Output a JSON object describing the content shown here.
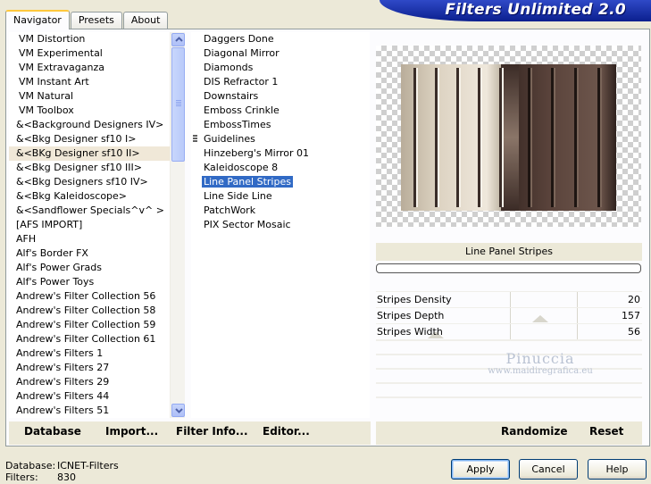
{
  "tabs": [
    {
      "label": "Navigator",
      "active": true
    },
    {
      "label": "Presets",
      "active": false
    },
    {
      "label": "About",
      "active": false
    }
  ],
  "banner": {
    "title": "Filters Unlimited 2.0"
  },
  "categories": [
    "VM Distortion",
    "VM Experimental",
    "VM Extravaganza",
    "VM Instant Art",
    "VM Natural",
    "VM Toolbox",
    "&<Background Designers IV>",
    "&<Bkg Designer sf10 I>",
    "&<BKg Designer sf10 II>",
    "&<Bkg Designer sf10 III>",
    "&<Bkg Designers sf10 IV>",
    "&<Bkg Kaleidoscope>",
    "&<Sandflower Specials^v^ >",
    "[AFS IMPORT]",
    "AFH",
    "Alf's Border FX",
    "Alf's Power Grads",
    "Alf's Power Toys",
    "Andrew's Filter Collection 56",
    "Andrew's Filter Collection 58",
    "Andrew's Filter Collection 59",
    "Andrew's Filter Collection 61",
    "Andrew's Filters 1",
    "Andrew's Filters 27",
    "Andrew's Filters 29",
    "Andrew's Filters 44",
    "Andrew's Filters 51"
  ],
  "selected_category": "&<BKg Designer sf10 II>",
  "filters": [
    "Daggers Done",
    "Diagonal Mirror",
    "Diamonds",
    "DIS Refractor 1",
    "Downstairs",
    "Emboss Crinkle",
    "EmbossTimes",
    "Guidelines",
    "Hinzeberg's Mirror 01",
    "Kaleidoscope 8",
    "Line Panel Stripes",
    "Line Side Line",
    "PatchWork",
    "PIX Sector Mosaic"
  ],
  "selected_filter": "Line Panel Stripes",
  "preview": {
    "filter_name": "Line Panel Stripes",
    "colors": {
      "light": "#ddd3c2",
      "dark": "#5b443c"
    }
  },
  "params": [
    {
      "name": "Stripes Density",
      "value": "20"
    },
    {
      "name": "Stripes Depth",
      "value": "157"
    },
    {
      "name": "Stripes Width",
      "value": "56"
    }
  ],
  "watermark": {
    "name": "Pinuccia",
    "url": "www.maidiregrafica.eu"
  },
  "toolbar": {
    "database": "Database",
    "import": "Import...",
    "filter_info": "Filter Info...",
    "editor": "Editor...",
    "randomize": "Randomize",
    "reset": "Reset"
  },
  "status": {
    "database_label": "Database:",
    "database_value": "ICNET-Filters",
    "filters_label": "Filters:",
    "filters_value": "830"
  },
  "buttons": {
    "apply": "Apply",
    "cancel": "Cancel",
    "help": "Help"
  }
}
